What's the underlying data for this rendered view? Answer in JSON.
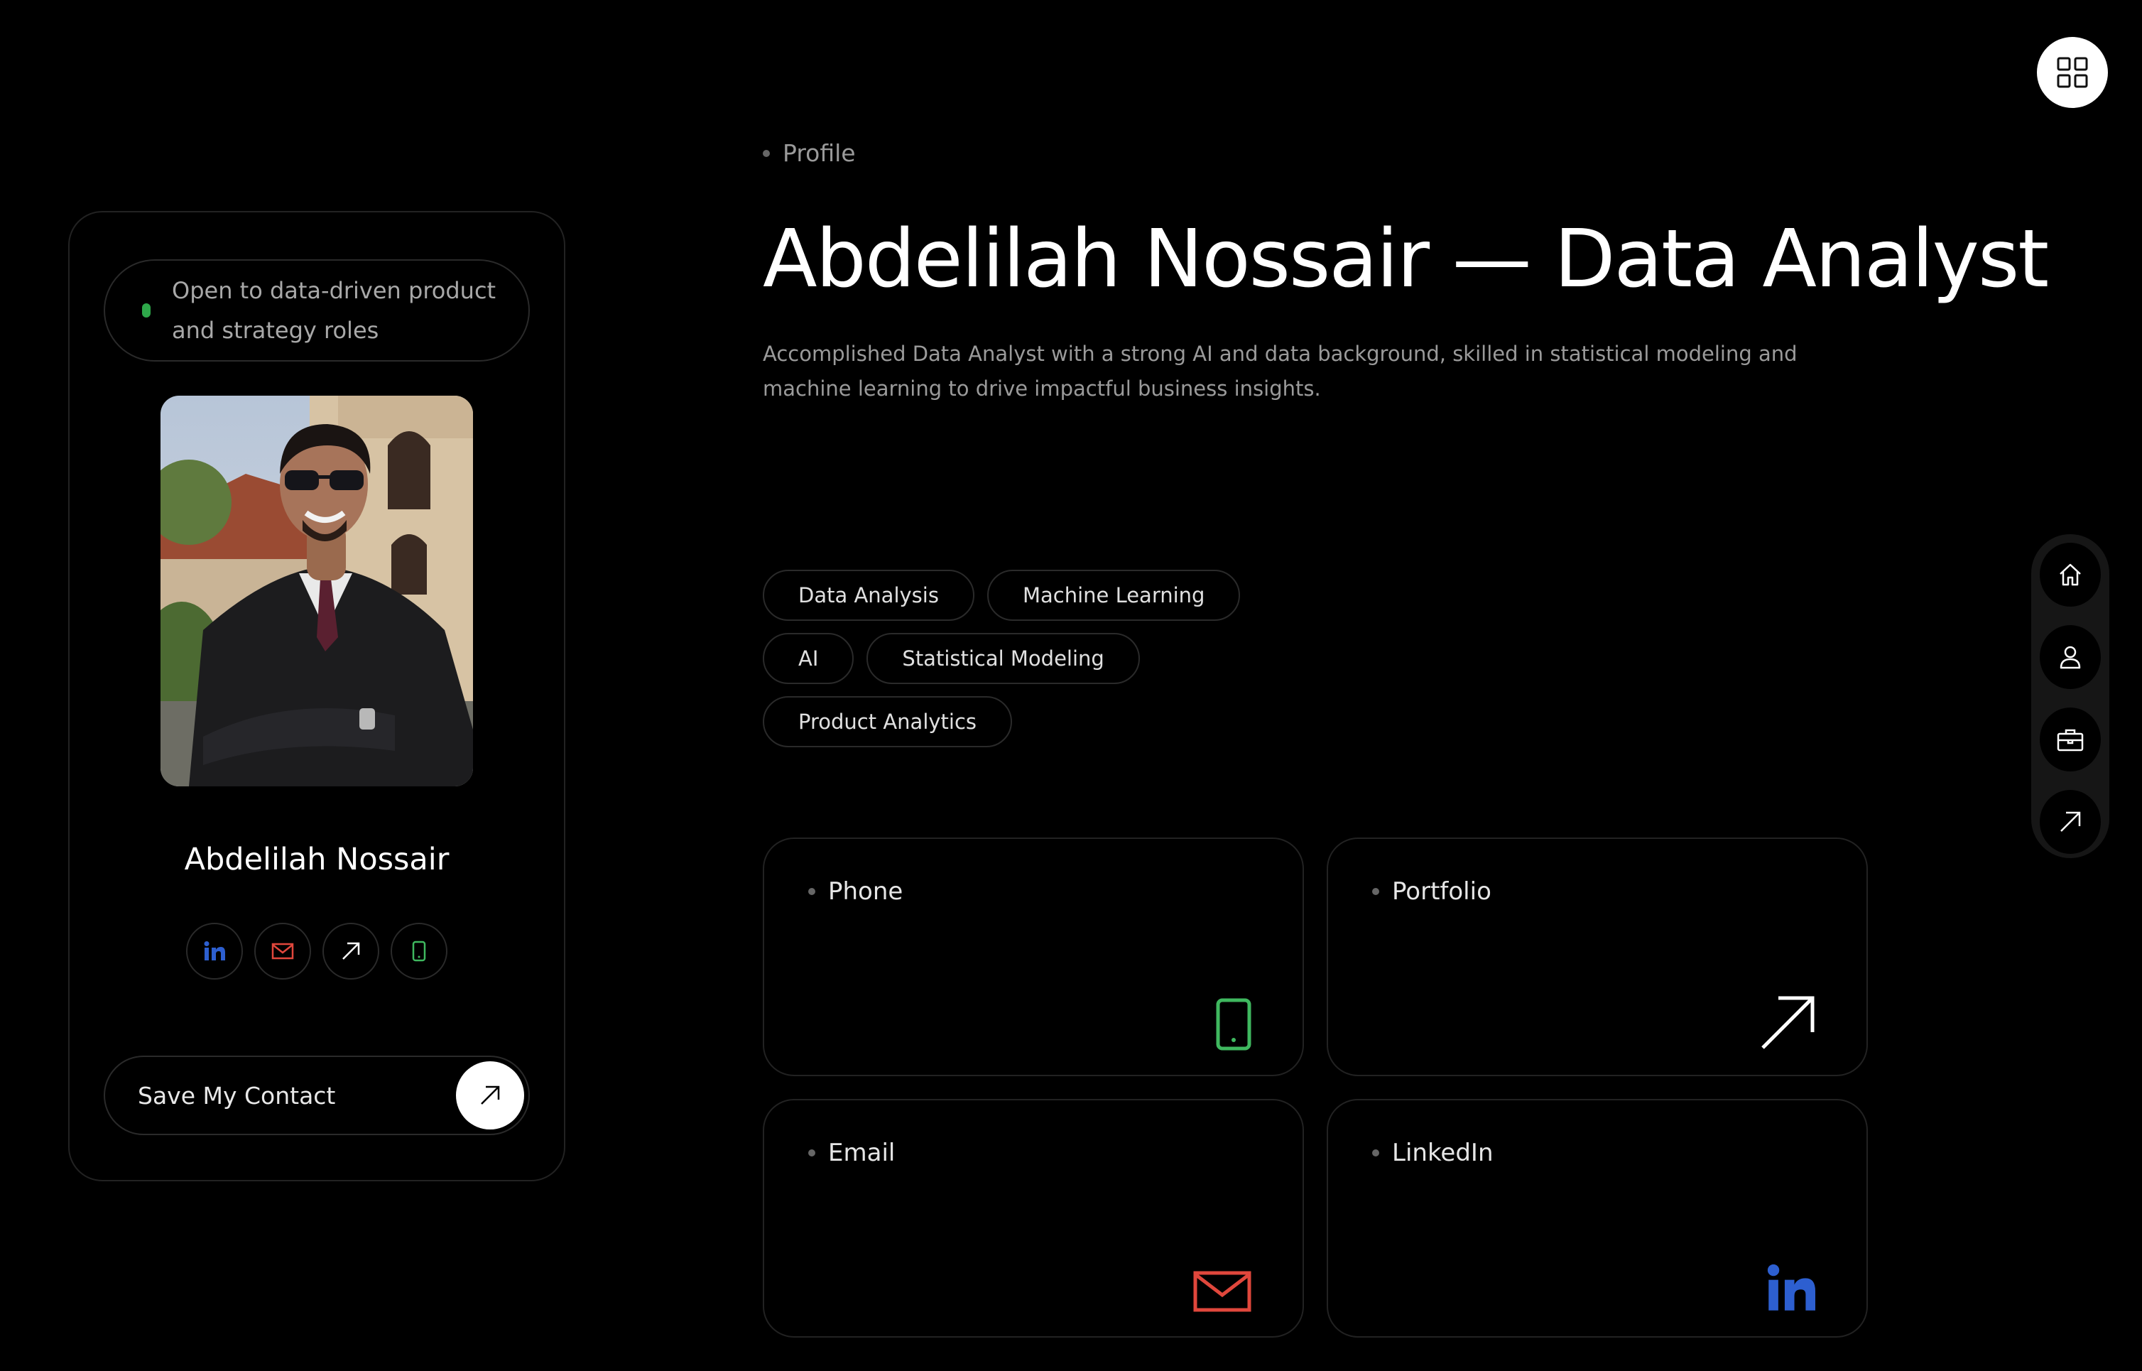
{
  "profile_card": {
    "status": "Open to data-driven product and strategy roles",
    "name": "Abdelilah Nossair",
    "socials": [
      {
        "icon": "linkedin-icon",
        "color": "#2d5fd0"
      },
      {
        "icon": "mail-icon",
        "color": "#e0473c"
      },
      {
        "icon": "arrow-up-right-icon",
        "color": "#ffffff"
      },
      {
        "icon": "phone-icon",
        "color": "#3fb85f"
      }
    ],
    "save_label": "Save My Contact"
  },
  "main": {
    "section_label": "Profile",
    "headline": "Abdelilah Nossair — Data Analyst",
    "summary": "Accomplished Data Analyst with a strong AI and data background, skilled in statistical modeling and machine learning to drive impactful business insights.",
    "skills": [
      "Data Analysis",
      "Machine Learning",
      "AI",
      "Statistical Modeling",
      "Product Analytics"
    ],
    "contacts": [
      {
        "label": "Phone",
        "icon": "phone-icon",
        "color": "#3fb85f"
      },
      {
        "label": "Portfolio",
        "icon": "arrow-up-right-icon",
        "color": "#ffffff"
      },
      {
        "label": "Email",
        "icon": "mail-icon",
        "color": "#e0473c"
      },
      {
        "label": "LinkedIn",
        "icon": "linkedin-icon",
        "color": "#2d5fd0"
      }
    ]
  },
  "rail": {
    "items": [
      "home-icon",
      "user-icon",
      "briefcase-icon",
      "arrow-up-right-icon"
    ]
  },
  "colors": {
    "accent_green": "#2ea84a",
    "background": "#000000"
  }
}
